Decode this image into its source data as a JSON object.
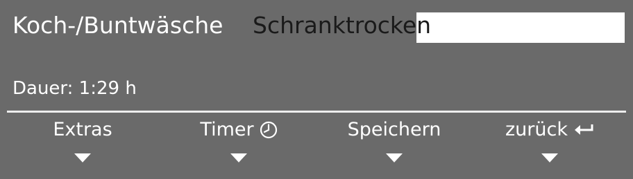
{
  "program": {
    "name": "Koch-/Buntwäsche",
    "selected_option": "Schranktrocken"
  },
  "duration": {
    "text": "Dauer: 1:29 h"
  },
  "softkeys": [
    {
      "label": "Extras",
      "icon": null
    },
    {
      "label": "Timer",
      "icon": "clock-icon"
    },
    {
      "label": "Speichern",
      "icon": null
    },
    {
      "label": "zurück",
      "icon": "return-arrow-icon"
    }
  ],
  "colors": {
    "display_background": "#6a6a6a",
    "text": "#ffffff",
    "highlight_background": "#ffffff",
    "highlight_text": "#1a1a1a"
  }
}
